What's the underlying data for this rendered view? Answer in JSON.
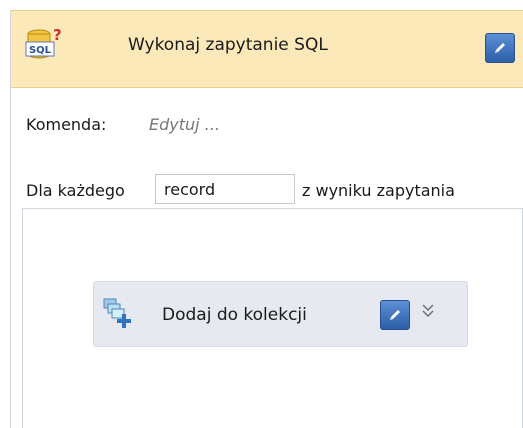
{
  "activity": {
    "title": "Wykonaj zapytanie SQL",
    "header_icon": "sql-query-icon",
    "edit_icon": "pencil-icon"
  },
  "command": {
    "label": "Komenda:",
    "value": "Edytuj ..."
  },
  "foreach": {
    "prefix": "Dla każdego",
    "variable": "record",
    "suffix": "z wyniku zapytania"
  },
  "inner_activity": {
    "title": "Dodaj do kolekcji",
    "icon": "add-to-collection-icon",
    "expand_icon": "chevron-double-down-icon",
    "expand_glyph": "»"
  },
  "colors": {
    "header_bg": "#fbe9b9",
    "edit_button": "#3a6fc0",
    "inner_bg": "#e6e9ef"
  }
}
